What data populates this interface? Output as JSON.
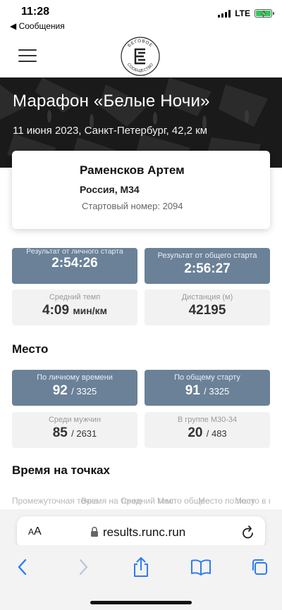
{
  "status_bar": {
    "time": "11:28",
    "back_label": "◀ Сообщения",
    "network": "LTE",
    "battery_fraction": 0.9
  },
  "header": {
    "logo_text_top": "БЕГОВОЕ",
    "logo_text_bottom": "СООБЩЕСТВО",
    "logo_monogram": "БС"
  },
  "event": {
    "title": "Марафон «Белые Ночи»",
    "subtitle": "11 июня 2023, Санкт-Петербург, 42,2 км"
  },
  "runner": {
    "name": "Раменсков Артем",
    "country_group": "Россия, М34",
    "bib": "Стартовый номер: 2094"
  },
  "results": {
    "net": {
      "label": "Результат от личного старта",
      "value": "2:54:26"
    },
    "gun": {
      "label": "Результат от общего старта",
      "value": "2:56:27"
    },
    "pace": {
      "label": "Средний темп",
      "value": "4:09",
      "unit": "мин/км"
    },
    "distance": {
      "label": "Дистанция (м)",
      "value": "42195"
    }
  },
  "place": {
    "heading": "Место",
    "by_net": {
      "label": "По личному времени",
      "value": "92",
      "total": "/ 3325"
    },
    "by_gun": {
      "label": "По общему старту",
      "value": "91",
      "total": "/ 3325"
    },
    "men": {
      "label": "Среди мужчин",
      "value": "85",
      "total": "/ 2631"
    },
    "group": {
      "label": "В группе М30-34",
      "value": "20",
      "total": "/ 483"
    }
  },
  "splits": {
    "heading": "Время на точках",
    "columns": [
      "Промежуточная точка",
      "Время на точке",
      "Средний темп",
      "Место общее",
      "Место по полу",
      "Место в группе"
    ]
  },
  "browser": {
    "aa_label": "AA",
    "url": "results.runc.run"
  },
  "colors": {
    "accent_tile": "#6a8198",
    "light_tile": "#f2f2f2",
    "battery": "#34c759"
  }
}
